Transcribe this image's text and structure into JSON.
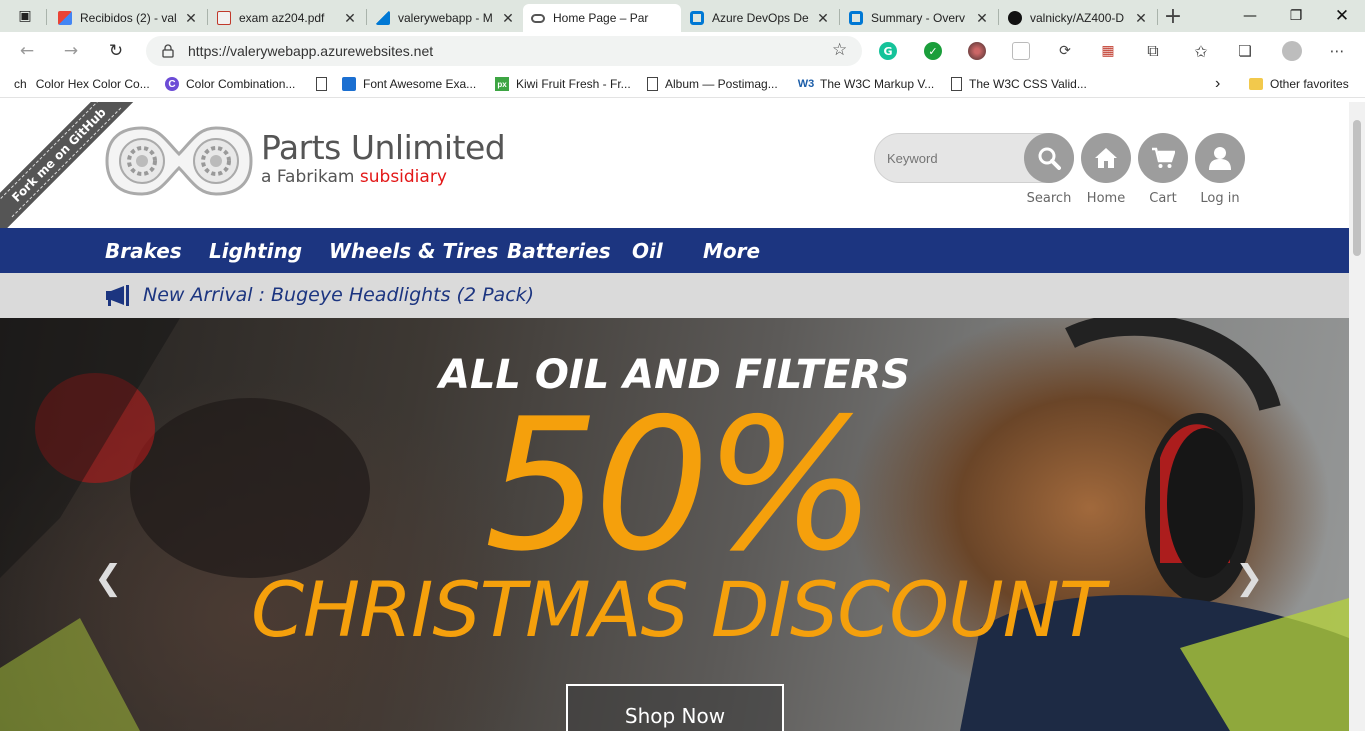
{
  "browser": {
    "tabs": [
      {
        "title": "Recibidos (2) - val",
        "icon": "gmail-icon",
        "color": "#d93025"
      },
      {
        "title": "exam az204.pdf",
        "icon": "pdf-icon",
        "color": "#c0392b"
      },
      {
        "title": "valerywebapp - M",
        "icon": "azure-icon",
        "color": "#0078d4"
      },
      {
        "title": "Home Page – Par",
        "icon": "parts-unlimited-icon",
        "color": "#555555"
      },
      {
        "title": "Azure DevOps De",
        "icon": "azure-devops-icon",
        "color": "#0078d4"
      },
      {
        "title": "Summary - Overv",
        "icon": "azure-devops-icon",
        "color": "#0078d4"
      },
      {
        "title": "valnicky/AZ400-D",
        "icon": "github-icon",
        "color": "#111111"
      }
    ],
    "url": "https://valerywebapp.azurewebsites.net",
    "bookmarks": [
      {
        "label": "Color Hex Color Co...",
        "icon": "colorhex-icon"
      },
      {
        "label": "Color Combination...",
        "icon": "colorcombos-icon"
      },
      {
        "label": "Font Awesome Exa...",
        "icon": "page-icon"
      },
      {
        "label": "Kiwi Fruit Fresh - Fr...",
        "icon": "flag-icon"
      },
      {
        "label": "Album — Postimag...",
        "icon": "px-icon"
      },
      {
        "label": "The W3C Markup V...",
        "icon": "page-icon"
      },
      {
        "label": "The W3C CSS Valid...",
        "icon": "w3-icon"
      }
    ],
    "bookmark_prefix": "ch",
    "other_favorites": "Other favorites"
  },
  "site": {
    "ribbon": "Fork me on GitHub",
    "brand": "Parts Unlimited",
    "tagline_prefix": "a Fabrikam",
    "tagline_highlight": "subsidiary",
    "search_placeholder": "Keyword",
    "labels": {
      "search": "Search",
      "home": "Home",
      "cart": "Cart",
      "login": "Log in"
    },
    "categories": [
      "Brakes",
      "Lighting",
      "Wheels & Tires",
      "Batteries",
      "Oil",
      "More"
    ],
    "announcement": "New Arrival : Bugeye Headlights (2 Pack)",
    "hero": {
      "line1": "ALL OIL AND FILTERS",
      "percent": "50%",
      "line3": "CHRISTMAS DISCOUNT",
      "button": "Shop Now"
    },
    "colors": {
      "nav": "#1c3580",
      "accent": "#f5a00c",
      "subsidiary": "#e31818"
    }
  }
}
